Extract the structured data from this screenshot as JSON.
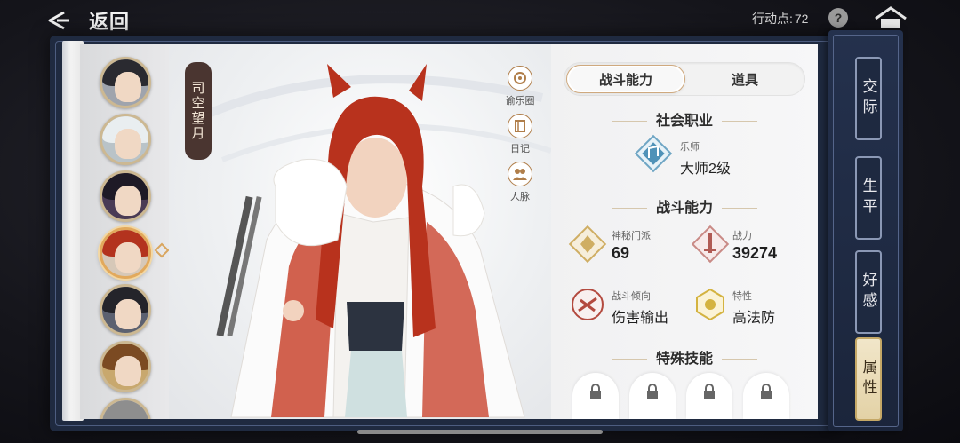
{
  "header": {
    "back_label": "返回",
    "action_points_label": "行动点:",
    "action_points_value": "72",
    "help_label": "?"
  },
  "character": {
    "name": "司空望月"
  },
  "quick_links": [
    {
      "label": "谕乐圈",
      "icon": "music-circle-icon"
    },
    {
      "label": "日记",
      "icon": "diary-icon"
    },
    {
      "label": "人脉",
      "icon": "contacts-icon"
    }
  ],
  "tabs": {
    "combat": "战斗能力",
    "items": "道具"
  },
  "career": {
    "section_title": "社会职业",
    "small": "乐师",
    "main": "大师2级"
  },
  "combat": {
    "section_title": "战斗能力",
    "sect_label": "神秘门派",
    "sect_value": "69",
    "power_label": "战力",
    "power_value": "39274",
    "tendency_label": "战斗倾向",
    "tendency_value": "伤害输出",
    "trait_label": "特性",
    "trait_value": "高法防"
  },
  "skills": {
    "section_title": "特殊技能",
    "slots": 4
  },
  "side_tabs": [
    "交际",
    "生平",
    "好感",
    "属性"
  ],
  "colors": {
    "accent_gold": "#cfa97e",
    "side_panel": "#1f2a40",
    "page_bg": "#f4f4f5"
  }
}
